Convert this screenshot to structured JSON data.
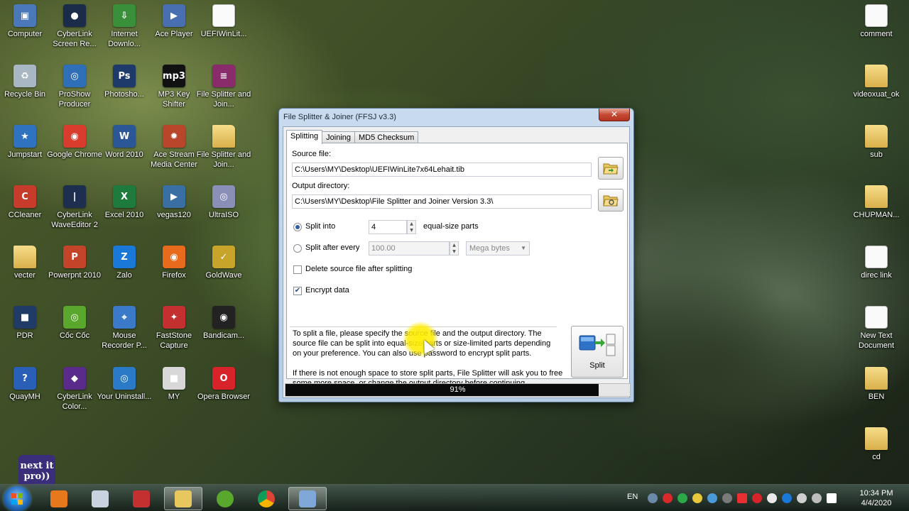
{
  "desktop": {
    "icons": [
      {
        "label": "Computer",
        "color": "#4a78b8",
        "glyph": "▣"
      },
      {
        "label": "CyberLink Screen Re...",
        "color": "#1b2c4a",
        "glyph": "●"
      },
      {
        "label": "Internet Downlo...",
        "color": "#3a8f3a",
        "glyph": "⇩"
      },
      {
        "label": "Ace Player",
        "color": "#4a6fb0",
        "glyph": "▶"
      },
      {
        "label": "UEFIWinLit...",
        "color": "#fafafa",
        "glyph": ""
      },
      {
        "label": "Recycle Bin",
        "color": "#a9b7c4",
        "glyph": "♻"
      },
      {
        "label": "ProShow Producer",
        "color": "#2f6fb8",
        "glyph": "◎"
      },
      {
        "label": "Photosho...",
        "color": "#1d3a6b",
        "glyph": "Ps"
      },
      {
        "label": "MP3 Key Shifter",
        "color": "#111111",
        "glyph": "mp3"
      },
      {
        "label": "File Splitter and Join...",
        "color": "#8a2b6b",
        "glyph": "≡"
      },
      {
        "label": "Jumpstart",
        "color": "#2f73c0",
        "glyph": "★"
      },
      {
        "label": "Google Chrome",
        "color": "#d93c2c",
        "glyph": "◉"
      },
      {
        "label": "Word 2010",
        "color": "#2b5797",
        "glyph": "W"
      },
      {
        "label": "Ace Stream Media Center",
        "color": "#b8462b",
        "glyph": "✹"
      },
      {
        "label": "File Splitter and Join...",
        "color": "#e8c85e",
        "glyph": ""
      },
      {
        "label": "CCleaner",
        "color": "#c73b2a",
        "glyph": "C"
      },
      {
        "label": "CyberLink WaveEditor 2",
        "color": "#1e2e4e",
        "glyph": "∣"
      },
      {
        "label": "Excel 2010",
        "color": "#1f7a3e",
        "glyph": "X"
      },
      {
        "label": "vegas120",
        "color": "#3a6fa3",
        "glyph": "▶"
      },
      {
        "label": "UltraISO",
        "color": "#8a8fb8",
        "glyph": "◎"
      },
      {
        "label": "vecter",
        "color": "#e8c85e",
        "glyph": ""
      },
      {
        "label": "Powerpnt 2010",
        "color": "#c4442a",
        "glyph": "P"
      },
      {
        "label": "Zalo",
        "color": "#1a78d8",
        "glyph": "Z"
      },
      {
        "label": "Firefox",
        "color": "#e86a1c",
        "glyph": "◉"
      },
      {
        "label": "GoldWave",
        "color": "#c8a52a",
        "glyph": "✓"
      },
      {
        "label": "PDR",
        "color": "#1f3b66",
        "glyph": "■"
      },
      {
        "label": "Cốc Cốc",
        "color": "#5aa72d",
        "glyph": "◎"
      },
      {
        "label": "Mouse Recorder P...",
        "color": "#3a7ac8",
        "glyph": "⌖"
      },
      {
        "label": "FastStone Capture",
        "color": "#c43030",
        "glyph": "✦"
      },
      {
        "label": "Bandicam...",
        "color": "#222222",
        "glyph": "◉"
      },
      {
        "label": "QuayMH",
        "color": "#2a5fb8",
        "glyph": "?"
      },
      {
        "label": "CyberLink Color...",
        "color": "#5a2b8a",
        "glyph": "◆"
      },
      {
        "label": "Your Uninstall...",
        "color": "#2a7ac8",
        "glyph": "◎"
      },
      {
        "label": "MY",
        "color": "#d8d8d8",
        "glyph": "■"
      },
      {
        "label": "Opera Browser",
        "color": "#d8232a",
        "glyph": "O"
      }
    ],
    "right_icons": [
      {
        "label": "comment"
      },
      {
        "label": "videoxuat_ok"
      },
      {
        "label": "sub"
      },
      {
        "label": "CHUPMAN..."
      },
      {
        "label": "direc link"
      },
      {
        "label": "New Text Document"
      },
      {
        "label": "BEN"
      },
      {
        "label": "cd"
      }
    ]
  },
  "dialog": {
    "title": "File Splitter & Joiner (FFSJ v3.3)",
    "close_glyph": "✕",
    "tabs": [
      "Splitting",
      "Joining",
      "MD5 Checksum"
    ],
    "active_tab": "Splitting",
    "source_label": "Source file:",
    "source_value": "C:\\Users\\MY\\Desktop\\UEFIWinLite7x64Lehait.tib",
    "output_label": "Output directory:",
    "output_value": "C:\\Users\\MY\\Desktop\\File Splitter and Joiner Version 3.3\\",
    "split_into_label": "Split into",
    "split_into_value": "4",
    "equal_size_label": "equal-size parts",
    "split_after_label": "Split after every",
    "split_after_value": "100.00",
    "unit_value": "Mega bytes",
    "delete_label": "Delete source file after splitting",
    "delete_checked": false,
    "encrypt_label": "Encrypt data",
    "encrypt_checked": true,
    "info_1a": "To split a file, please specify the source file and the output directory. The",
    "info_1b": "source file can be split into equal-size parts or size-limited parts depending",
    "info_1c": "on your preference. You can also use password to encrypt split parts.",
    "info_2a": "If there is not enough space to store split parts, File Splitter will ask you to free",
    "info_2b": "some more space, or change the output directory before continuing.",
    "split_button": "Split",
    "progress_value": 0.91,
    "progress_text": "91%"
  },
  "taskbar": {
    "lang": "EN",
    "time": "10:34 PM",
    "date": "4/4/2020"
  },
  "watermark": {
    "line1": "next it",
    "line2": "pro))"
  }
}
